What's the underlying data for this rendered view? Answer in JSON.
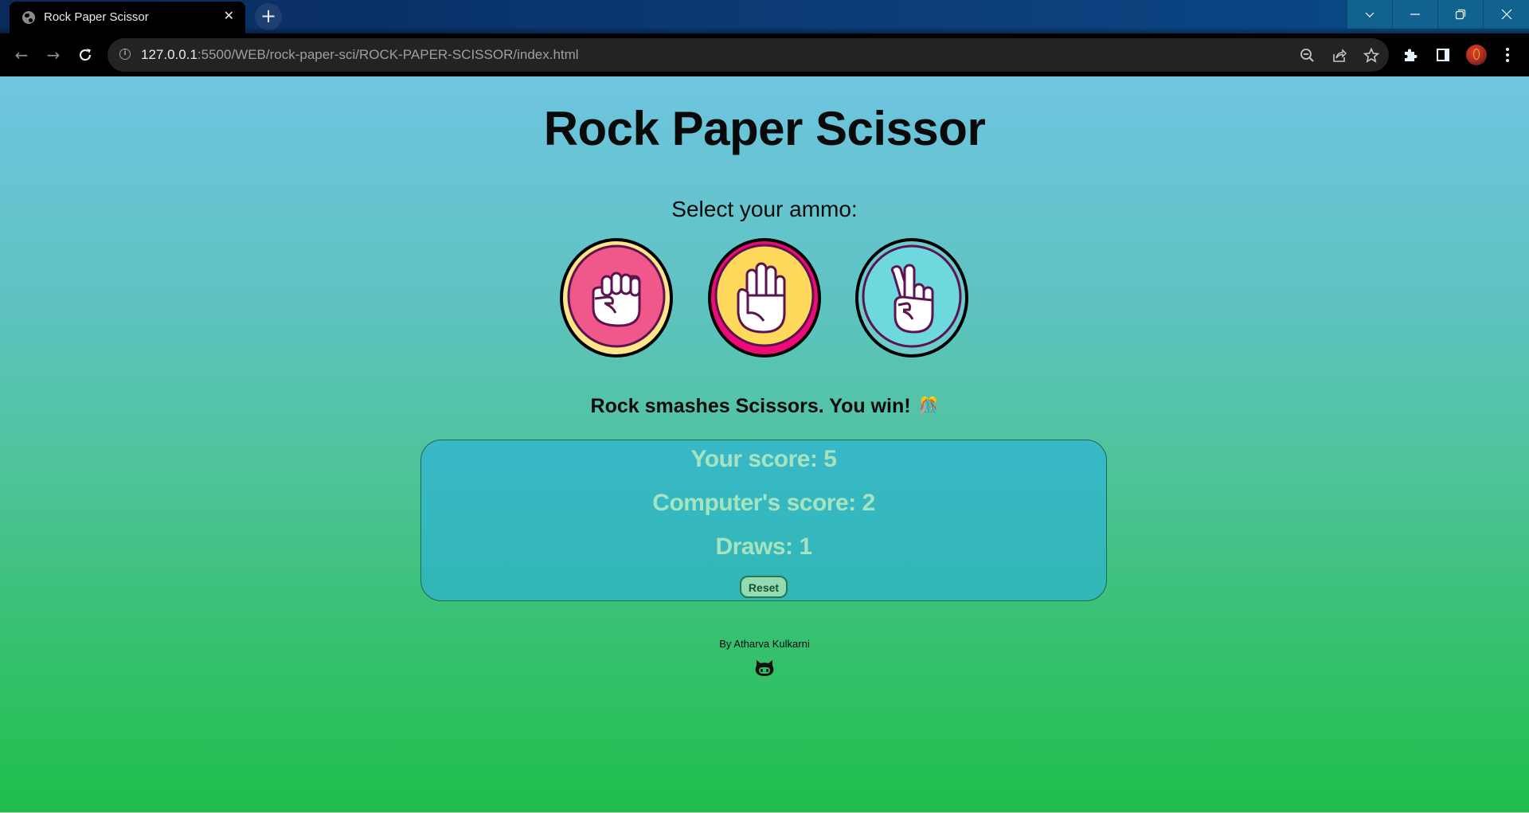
{
  "browser": {
    "tab": {
      "title": "Rock Paper Scissor",
      "favicon": "globe-icon",
      "close_icon": "close-icon"
    },
    "new_tab_icon": "plus-icon",
    "window_controls": [
      "chevron-down-icon",
      "minimize-icon",
      "restore-icon",
      "close-icon"
    ],
    "nav": {
      "back": "←",
      "forward": "→",
      "reload": "⟳"
    },
    "address": {
      "host": "127.0.0.1",
      "rest": ":5500/WEB/rock-paper-sci/ROCK-PAPER-SCISSOR/index.html"
    },
    "omnibox_icons": [
      "zoom-out-icon",
      "share-icon",
      "star-icon"
    ],
    "toolbar_icons": [
      "extensions-icon",
      "side-panel-icon",
      "profile-avatar",
      "menu-icon"
    ]
  },
  "page": {
    "title": "Rock Paper Scissor",
    "subtitle": "Select your ammo:",
    "choices": [
      {
        "id": "rock",
        "label": "Rock",
        "icon": "fist-icon",
        "ring": "#ffe58a",
        "fill": "#f0578a"
      },
      {
        "id": "paper",
        "label": "Paper",
        "icon": "open-hand-icon",
        "ring": "#f00a78",
        "fill": "#ffd95c"
      },
      {
        "id": "scissors",
        "label": "Scissors",
        "icon": "peace-hand-icon",
        "ring": "#6ccbcb",
        "fill": "#6ed8df"
      }
    ],
    "result": {
      "text": "Rock smashes Scissors. You win!",
      "emoji": "🎊"
    },
    "scores": {
      "player": "Your score: 5",
      "computer": "Computer's score: 2",
      "draws": "Draws: 1",
      "player_value": 5,
      "computer_value": 2,
      "draws_value": 1
    },
    "reset_label": "Reset",
    "credit": "By Atharva Kulkarni",
    "github_icon": "github-icon"
  },
  "colors": {
    "bg_top": "#6ec5e0",
    "bg_bottom": "#1fbf4b",
    "score_text": "#a6e3c0",
    "outline": "#5c1450"
  }
}
